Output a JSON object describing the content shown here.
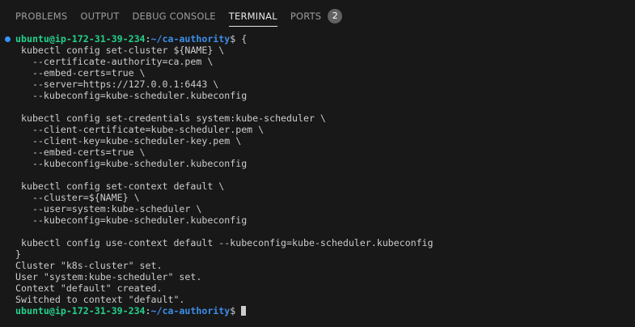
{
  "tabs": [
    {
      "label": "PROBLEMS"
    },
    {
      "label": "OUTPUT"
    },
    {
      "label": "DEBUG CONSOLE"
    },
    {
      "label": "TERMINAL",
      "active": true
    },
    {
      "label": "PORTS",
      "badge": "2"
    }
  ],
  "terminal": {
    "prompt": {
      "user_host": "ubuntu@ip-172-31-39-234",
      "colon": ":",
      "path": "~/ca-authority",
      "symbol": "$ "
    },
    "first_command_suffix": "{",
    "lines": [
      " kubectl config set-cluster ${NAME} \\",
      "   --certificate-authority=ca.pem \\",
      "   --embed-certs=true \\",
      "   --server=https://127.0.0.1:6443 \\",
      "   --kubeconfig=kube-scheduler.kubeconfig",
      "",
      " kubectl config set-credentials system:kube-scheduler \\",
      "   --client-certificate=kube-scheduler.pem \\",
      "   --client-key=kube-scheduler-key.pem \\",
      "   --embed-certs=true \\",
      "   --kubeconfig=kube-scheduler.kubeconfig",
      "",
      " kubectl config set-context default \\",
      "   --cluster=${NAME} \\",
      "   --user=system:kube-scheduler \\",
      "   --kubeconfig=kube-scheduler.kubeconfig",
      "",
      " kubectl config use-context default --kubeconfig=kube-scheduler.kubeconfig",
      "}",
      "Cluster \"k8s-cluster\" set.",
      "User \"system:kube-scheduler\" set.",
      "Context \"default\" created.",
      "Switched to context \"default\"."
    ]
  },
  "colors": {
    "background": "#181818",
    "prompt_user": "#23d18b",
    "prompt_path": "#3b8eea",
    "status_dot": "#3794ff",
    "text": "#cccccc"
  }
}
